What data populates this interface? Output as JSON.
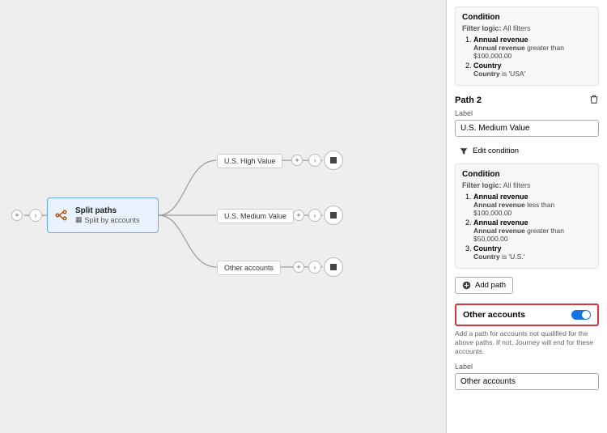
{
  "canvas": {
    "split": {
      "title": "Split paths",
      "subtitle": "Split by accounts"
    },
    "branches": [
      {
        "label": "U.S. High Value"
      },
      {
        "label": "U.S. Medium Value"
      },
      {
        "label": "Other accounts"
      }
    ]
  },
  "panel": {
    "path1": {
      "condition_title": "Condition",
      "filter_logic_label": "Filter logic:",
      "filter_logic_value": "All filters",
      "rules": [
        {
          "field": "Annual revenue",
          "detail_field": "Annual revenue",
          "op": "greater than",
          "value": "$100,000.00"
        },
        {
          "field": "Country",
          "detail_field": "Country",
          "op": "is",
          "value": "'USA'"
        }
      ]
    },
    "path2": {
      "title": "Path 2",
      "label_caption": "Label",
      "label_value": "U.S. Medium Value",
      "edit_condition": "Edit condition",
      "condition_title": "Condition",
      "filter_logic_label": "Filter logic:",
      "filter_logic_value": "All filters",
      "rules": [
        {
          "field": "Annual revenue",
          "detail_field": "Annual revenue",
          "op": "less than",
          "value": "$100,000.00"
        },
        {
          "field": "Annual revenue",
          "detail_field": "Annual revenue",
          "op": "greater than",
          "value": "$50,000.00"
        },
        {
          "field": "Country",
          "detail_field": "Country",
          "op": "is",
          "value": "'U.S.'"
        }
      ]
    },
    "add_path": "Add path",
    "other": {
      "title": "Other accounts",
      "help": "Add a path for accounts not qualified for the above paths. If not, Journey will end for these accounts.",
      "label_caption": "Label",
      "label_value": "Other accounts",
      "toggle_on": true
    }
  }
}
